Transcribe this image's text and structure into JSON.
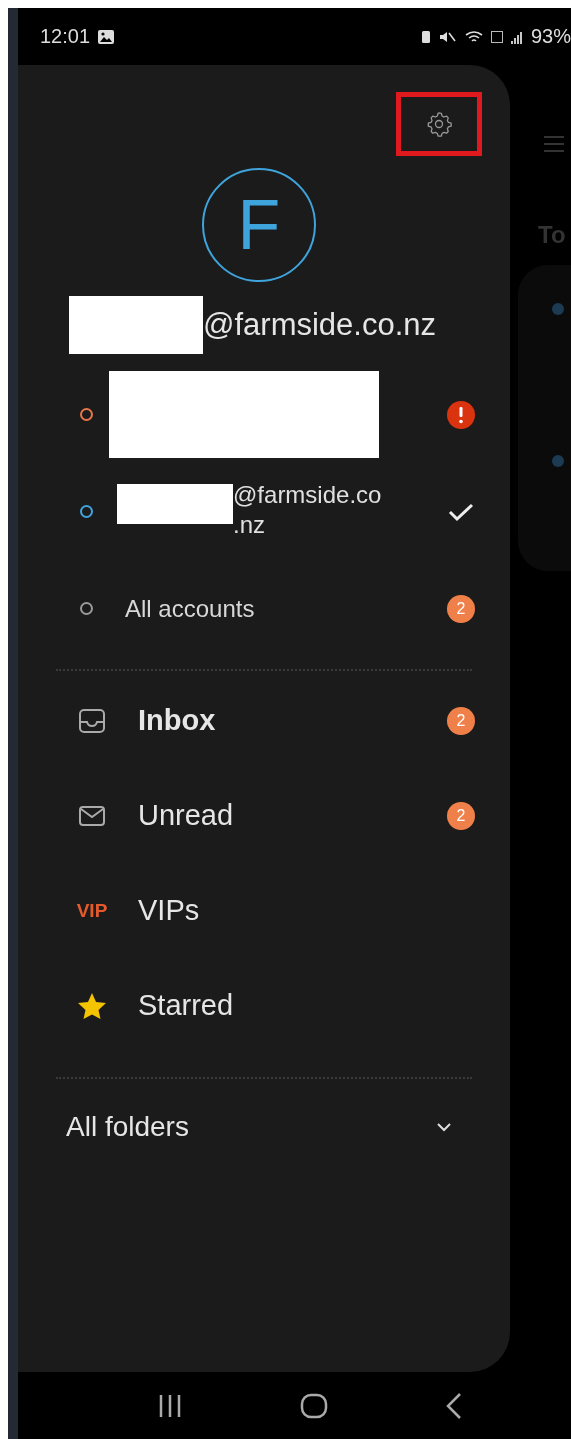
{
  "status_bar": {
    "time": "12:01",
    "battery": "93%"
  },
  "drawer": {
    "settings": {
      "highlighted": true
    },
    "avatar_letter": "F",
    "account_email": "@farmside.co.nz",
    "accounts": [
      {
        "kind": "redacted",
        "color": "#e8764a",
        "selected": false,
        "badge": {
          "kind": "error"
        }
      },
      {
        "kind": "partly_redacted",
        "label": "@farmside.co\n.nz",
        "color": "#3fa3dc",
        "selected": true
      },
      {
        "kind": "plain",
        "label": "All accounts",
        "color": "#9a9a9a",
        "selected": false,
        "badge": {
          "kind": "count",
          "count": "2"
        }
      }
    ],
    "folders": [
      {
        "kind": "inbox",
        "label": "Inbox",
        "selected": true,
        "count": "2"
      },
      {
        "kind": "mail",
        "label": "Unread",
        "selected": false,
        "count": "2"
      },
      {
        "kind": "vip",
        "icon_text": "VIP",
        "label": "VIPs",
        "selected": false
      },
      {
        "kind": "star",
        "label": "Starred",
        "selected": false
      }
    ],
    "all_folders": {
      "label": "All folders",
      "expanded": false
    }
  },
  "background_screen": {
    "heading": "To"
  }
}
